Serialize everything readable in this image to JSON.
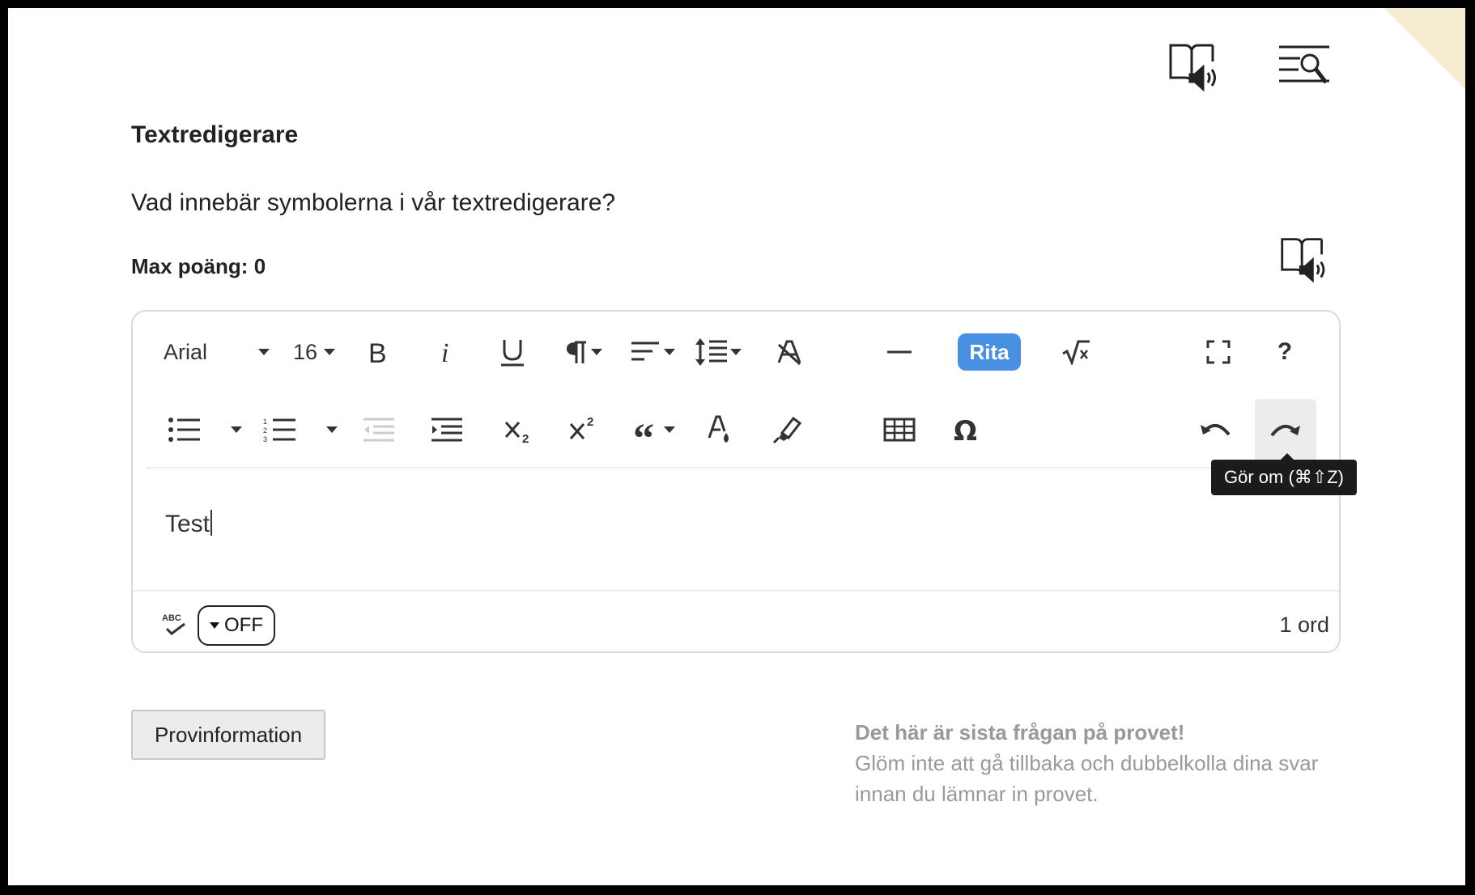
{
  "page": {
    "title": "Textredigerare",
    "question": "Vad innebär symbolerna i vår textredigerare?",
    "max_points_label": "Max poäng:",
    "max_points_value": "0"
  },
  "toolbar": {
    "font_family": "Arial",
    "font_size": "16",
    "rita_label": "Rita",
    "help_label": "?"
  },
  "editor": {
    "content": "Test",
    "spellcheck_toggle": "OFF",
    "word_count": "1 ord"
  },
  "tooltip": {
    "text": "Gör om (⌘⇧Z)"
  },
  "footer": {
    "provinformation_label": "Provinformation",
    "notice_title": "Det här är sista frågan på provet!",
    "notice_body": "Glöm inte att gå tillbaka och dubbelkolla dina svar innan du lämnar in provet."
  },
  "colors": {
    "accent": "#4a90e2",
    "tooltip_bg": "#1b1b1b",
    "corner": "#f6ecd2",
    "muted_text": "#999999"
  },
  "icons": {
    "top": [
      "read-aloud-book-icon",
      "search-text-icon"
    ],
    "question": "read-aloud-book-icon"
  }
}
